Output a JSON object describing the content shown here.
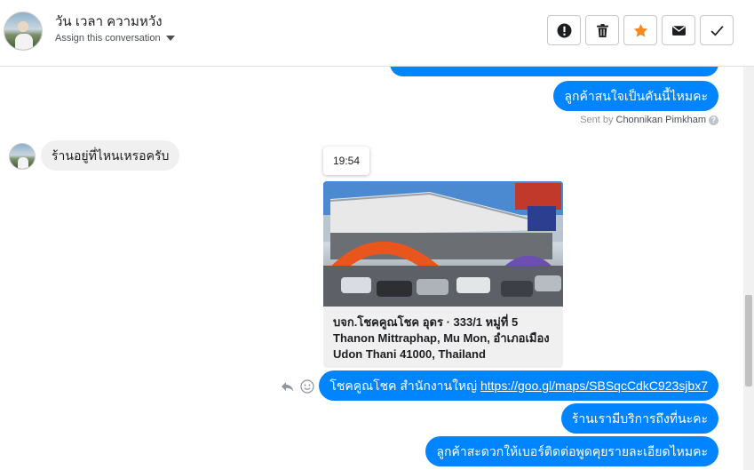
{
  "header": {
    "contact_name": "วัน เวลา ความหวัง",
    "assign_label": "Assign this conversation",
    "actions": [
      {
        "name": "spam-button",
        "icon": "exclamation-icon"
      },
      {
        "name": "delete-button",
        "icon": "trash-icon"
      },
      {
        "name": "star-button",
        "icon": "star-icon",
        "color": "#f68a1f"
      },
      {
        "name": "mark-unread-button",
        "icon": "envelope-icon"
      },
      {
        "name": "mark-done-button",
        "icon": "check-icon"
      }
    ]
  },
  "thread": {
    "msg_out_1": "ลูกค้าสนใจเป็นคันนี้ไหมคะ",
    "sent_by_prefix": "Sent by",
    "sent_by_name": "Chonnikan Pimkham",
    "help": "?",
    "msg_in_1": "ร้านอยู่ที่ไหนเหรอครับ",
    "time_tooltip": "19:54",
    "location_card": {
      "text": "บจก.โชคคูณโชค อุดร · 333/1 หมู่ที่ 5 Thanon Mittraphap, Mu Mon, อำเภอเมือง Udon Thani 41000, Thailand"
    },
    "msg_out_link_prefix": "โชคคูณโชค สำนักงานใหญ่ ",
    "msg_out_link_url": "https://goo.gl/maps/SBSqcCdkC923sjbx7",
    "msg_out_3": "ร้านเรามีบริการถึงที่นะคะ",
    "msg_out_4": "ลูกค้าสะดวกให้เบอร์ติดต่อพูดคุยรายละเอียดไหมคะ"
  },
  "colors": {
    "accent": "#0084ff",
    "incoming_bubble": "#f1f0f0",
    "star": "#f68a1f"
  }
}
